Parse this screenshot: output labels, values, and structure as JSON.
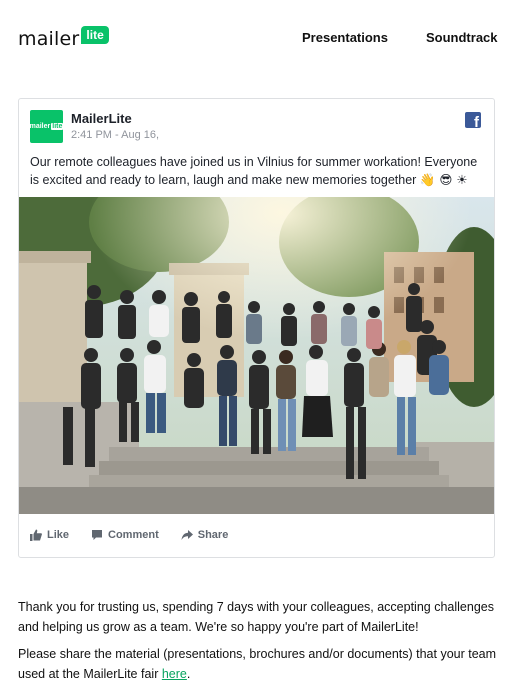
{
  "header": {
    "logo_word": "mailer",
    "logo_badge": "lite",
    "nav": [
      {
        "label": "Presentations"
      },
      {
        "label": "Soundtrack"
      }
    ]
  },
  "post": {
    "avatar_text": "mailer",
    "avatar_badge": "lite",
    "author": "MailerLite",
    "timestamp": "2:41 PM - Aug 16,",
    "text": "Our remote colleagues have joined us in Vilnius for summer workation! Everyone is excited and ready to learn, laugh and make new memories together",
    "emojis": "👋 😎 ☀",
    "actions": [
      {
        "label": "Like",
        "icon": "thumbs-up-icon"
      },
      {
        "label": "Comment",
        "icon": "comment-icon"
      },
      {
        "label": "Share",
        "icon": "share-arrow-icon"
      }
    ],
    "icon": "facebook-icon"
  },
  "body": {
    "paragraph1": "Thank you for trusting us, spending 7 days with your colleagues, accepting challenges and helping us grow as a team. We're so happy you're part of MailerLite!",
    "paragraph2_prefix": "Please share the material (presentations, brochures and/or documents) that your team used at the MailerLite fair",
    "paragraph2_link": "here",
    "paragraph2_suffix": "."
  },
  "colors": {
    "brand_green": "#09c269",
    "facebook_blue": "#3b5998",
    "link_green": "#09a45f"
  }
}
